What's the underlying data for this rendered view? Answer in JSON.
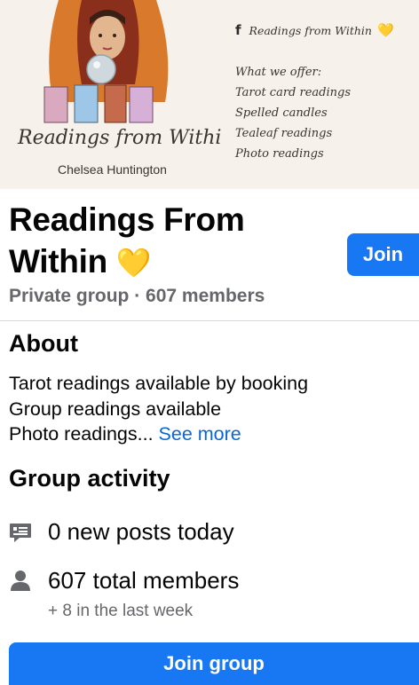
{
  "cover": {
    "logo_script": "Readings from Within",
    "author": "Chelsea Huntington",
    "fb_icon": "facebook-f-icon",
    "fb_page_name": "Readings from Within",
    "fb_heart": "💛",
    "offer_title": "What we offer:",
    "offers": [
      "Tarot card readings",
      "Spelled candles",
      "Tealeaf readings",
      "Photo readings"
    ]
  },
  "header": {
    "title": "Readings From Within",
    "title_emoji": "💛",
    "join_label": "Join",
    "privacy": "Private group",
    "separator": " · ",
    "member_count": "607 members"
  },
  "about": {
    "heading": "About",
    "lines": [
      "Tarot readings available by booking",
      "Group readings available",
      "Photo readings..."
    ],
    "see_more": "See more"
  },
  "activity": {
    "heading": "Group activity",
    "posts_icon": "posts-icon",
    "posts_text": "0 new posts today",
    "members_icon": "person-icon",
    "members_text": "607 total members",
    "members_sub": "+ 8 in the last week"
  },
  "footer": {
    "join_group_label": "Join group"
  },
  "colors": {
    "accent": "#1877f2",
    "link": "#0a66d6",
    "secondary_text": "#65676b"
  }
}
